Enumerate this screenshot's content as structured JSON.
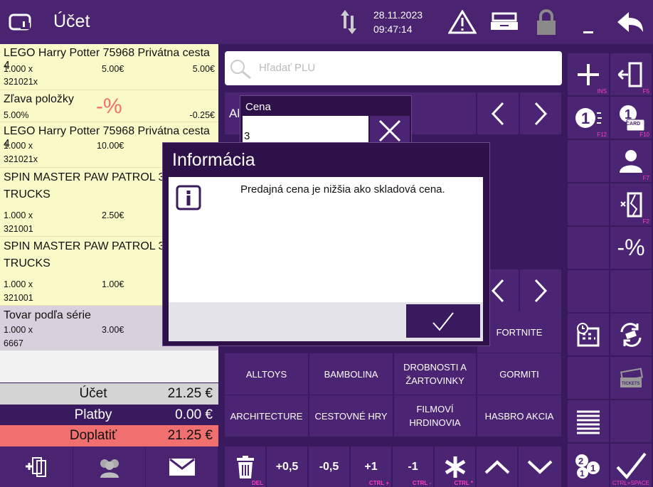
{
  "topbar": {
    "title": "Účet",
    "date": "28.11.2023",
    "time": "09:47:14"
  },
  "receipt": [
    {
      "name": "LEGO Harry Potter 75968 Privátna cesta 4",
      "qty": "1.000 x",
      "price": "5.00€",
      "total": "5.00€",
      "code": "321021x"
    },
    {
      "name": "Zľava položky",
      "discount_sign": "-%",
      "qty": "5.00%",
      "total": "-0.25€"
    },
    {
      "name": "LEGO Harry Potter 75968 Privátna cesta 4",
      "qty": "1.000 x",
      "price": "10.00€",
      "code": "321021x"
    },
    {
      "name": "SPIN MASTER PAW PATROL 362",
      "name2": "TRUCKS",
      "qty": "1.000 x",
      "price": "2.50€",
      "code": "321001"
    },
    {
      "name": "SPIN MASTER PAW PATROL 362",
      "name2": "TRUCKS",
      "qty": "1.000 x",
      "price": "1.00€",
      "code": "321001"
    },
    {
      "name": "Tovar podľa série",
      "qty": "1.000 x",
      "price": "3.00€",
      "code": "6667"
    }
  ],
  "totals": {
    "ucet_label": "Účet",
    "ucet_value": "21.25 €",
    "platby_label": "Platby",
    "platby_value": "0.00 €",
    "doplatit_label": "Doplatiť",
    "doplatit_value": "21.25 €"
  },
  "search": {
    "placeholder": "Hľadať PLU"
  },
  "categories_row1": [
    "FORTNITE"
  ],
  "categories_row2": [
    "ALLTOYS",
    "BAMBOLINA",
    "DROBNOSTI A ŽARTOVINKY",
    "GORMITI"
  ],
  "categories_row3": [
    "ARCHITECTURE",
    "CESTOVNÉ HRY",
    "FILMOVÍ HRDINOVIA",
    "HASBRO AKCIA"
  ],
  "behind_label": "Al",
  "numpad": {
    "plus05": "+0,5",
    "minus05": "-0,5",
    "plus1": "+1",
    "minus1": "-1",
    "del_key": "DEL",
    "ctrl_plus": "CTRL +",
    "ctrl_minus": "CTRL -",
    "ctrl_star": "CTRL *"
  },
  "right_keys": {
    "ins": "INS",
    "f5": "F5",
    "f12": "F12",
    "f10": "F10",
    "f7": "F7",
    "f2": "F2",
    "ctrl_space": "CTRL+SPACE",
    "card": "CARD",
    "tickets": "TICKETS",
    "percent": "-%"
  },
  "cena_dialog": {
    "title": "Cena",
    "value": "3"
  },
  "info_dialog": {
    "title": "Informácia",
    "message": "Predajná cena je nižšia ako skladová cena."
  },
  "colors": {
    "bg": "#3a1a5e",
    "button": "#4b2473",
    "receipt_item": "#fafac8",
    "doplatit": "#f07070",
    "fkey": "#ff3ec8"
  }
}
